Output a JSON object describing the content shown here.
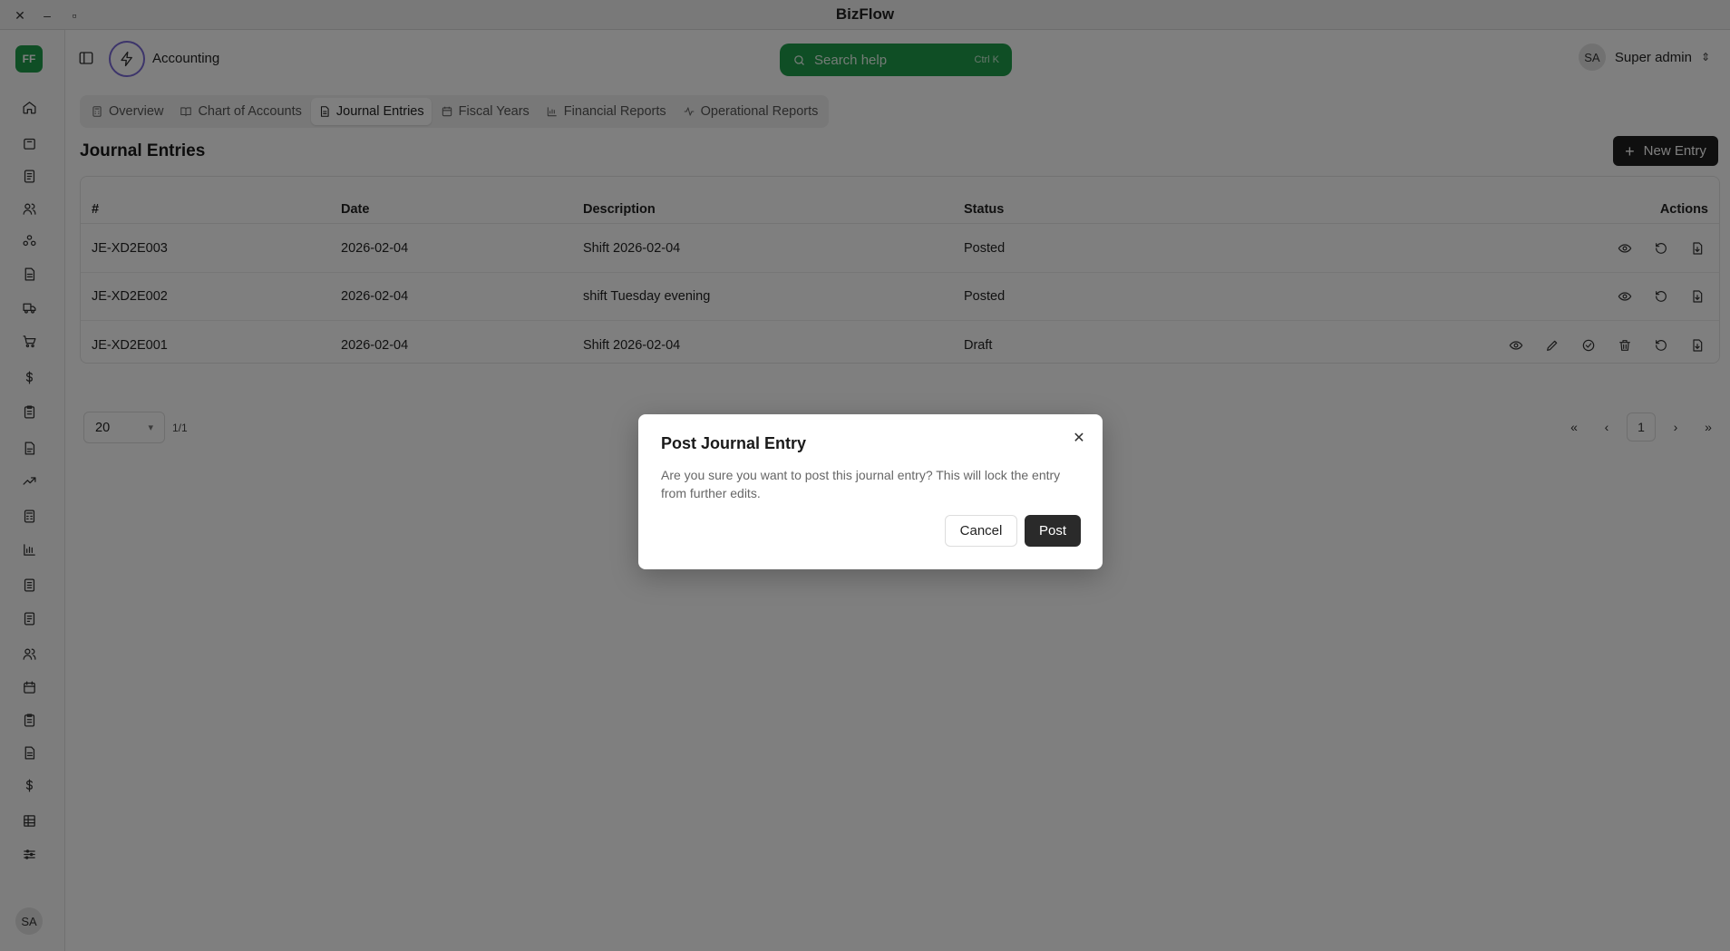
{
  "window": {
    "title": "BizFlow"
  },
  "sidebar": {
    "logo": "FF",
    "icons": [
      "home-icon",
      "box-icon",
      "document-icon",
      "users-icon",
      "network-icon",
      "document-icon",
      "truck-icon",
      "cart-icon",
      "dollar-icon",
      "clipboard-icon",
      "file-icon",
      "trend-icon",
      "calculator-icon",
      "bar-chart-icon",
      "receipt-icon",
      "file-text-icon",
      "contacts-icon",
      "calendar-icon",
      "clipboard-list-icon",
      "file-lines-icon",
      "dollar-alt-icon",
      "grid-icon",
      "sliders-icon"
    ],
    "user_initials": "SA"
  },
  "header": {
    "module": "Accounting",
    "search_placeholder": "Search help",
    "search_shortcut": "Ctrl K",
    "user_initials": "SA",
    "user_name": "Super admin"
  },
  "tabs": [
    {
      "label": "Overview",
      "icon": "calculator-icon"
    },
    {
      "label": "Chart of Accounts",
      "icon": "book-icon"
    },
    {
      "label": "Journal Entries",
      "icon": "file-icon",
      "active": true
    },
    {
      "label": "Fiscal Years",
      "icon": "calendar-icon"
    },
    {
      "label": "Financial Reports",
      "icon": "bar-chart-icon"
    },
    {
      "label": "Operational Reports",
      "icon": "activity-icon"
    }
  ],
  "page": {
    "title": "Journal Entries",
    "new_entry_label": "New Entry"
  },
  "table": {
    "columns": [
      "#",
      "Date",
      "Description",
      "Status",
      "Actions"
    ],
    "rows": [
      {
        "id": "JE-XD2E003",
        "date": "2026-02-04",
        "description": "Shift 2026-02-04",
        "status": "Posted"
      },
      {
        "id": "JE-XD2E002",
        "date": "2026-02-04",
        "description": "shift Tuesday evening",
        "status": "Posted"
      },
      {
        "id": "JE-XD2E001",
        "date": "2026-02-04",
        "description": "Shift 2026-02-04",
        "status": "Draft"
      }
    ]
  },
  "pagination": {
    "page_size": "20",
    "count": "1/1",
    "current_page": "1"
  },
  "dialog": {
    "title": "Post Journal Entry",
    "message": "Are you sure you want to post this journal entry? This will lock the entry from further edits.",
    "cancel_label": "Cancel",
    "confirm_label": "Post"
  },
  "colors": {
    "brand_green": "#1f9d4b",
    "dark_button": "#1f1f1f",
    "accent_ring": "#7b6bd6"
  }
}
